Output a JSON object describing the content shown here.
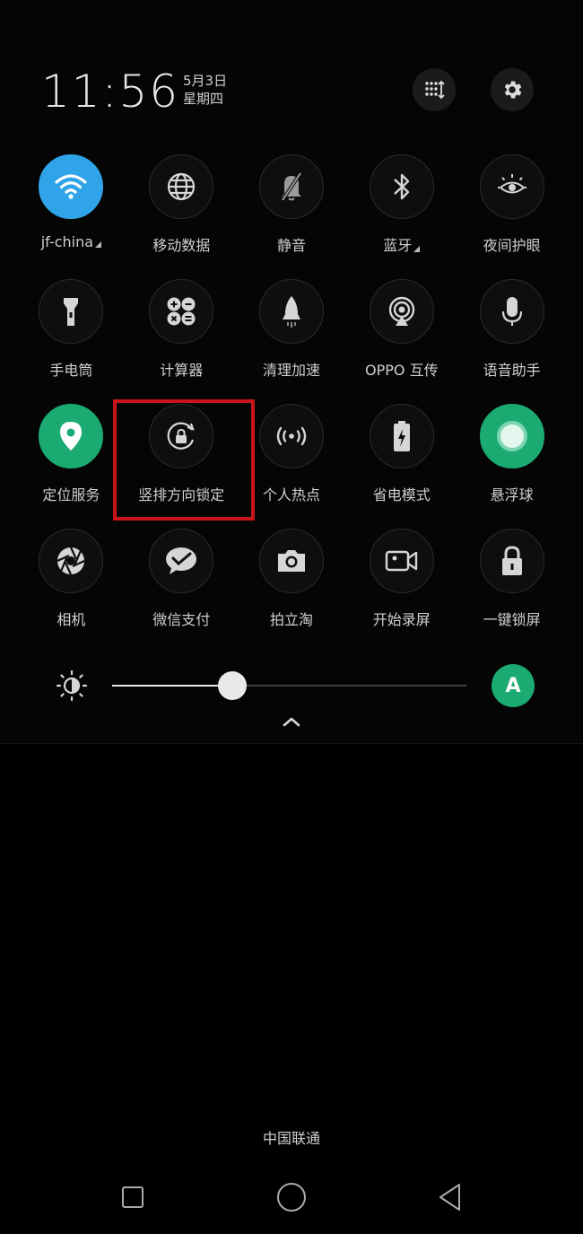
{
  "status": {
    "time": "11:56",
    "date": "5月3日",
    "weekday": "星期四"
  },
  "header_buttons": [
    {
      "name": "edit-tiles-button",
      "icon": "grid-sort-icon"
    },
    {
      "name": "settings-button",
      "icon": "gear-icon"
    }
  ],
  "tiles": [
    {
      "label": "jf-china",
      "icon": "wifi-icon",
      "active": "blue",
      "expandable": true
    },
    {
      "label": "移动数据",
      "icon": "globe-icon"
    },
    {
      "label": "静音",
      "icon": "bell-off-icon"
    },
    {
      "label": "蓝牙",
      "icon": "bluetooth-icon",
      "expandable": true
    },
    {
      "label": "夜间护眼",
      "icon": "eye-sun-icon"
    },
    {
      "label": "手电筒",
      "icon": "flashlight-icon"
    },
    {
      "label": "计算器",
      "icon": "calculator-icon"
    },
    {
      "label": "清理加速",
      "icon": "rocket-icon"
    },
    {
      "label": "OPPO 互传",
      "icon": "share-signal-icon"
    },
    {
      "label": "语音助手",
      "icon": "microphone-icon"
    },
    {
      "label": "定位服务",
      "icon": "location-pin-icon",
      "active": "green"
    },
    {
      "label": "竖排方向锁定",
      "icon": "rotation-lock-icon"
    },
    {
      "label": "个人热点",
      "icon": "hotspot-icon"
    },
    {
      "label": "省电模式",
      "icon": "battery-saver-icon"
    },
    {
      "label": "悬浮球",
      "icon": "floating-ball-icon",
      "active": "green"
    },
    {
      "label": "相机",
      "icon": "aperture-icon"
    },
    {
      "label": "微信支付",
      "icon": "wechat-pay-icon"
    },
    {
      "label": "拍立淘",
      "icon": "camera-icon"
    },
    {
      "label": "开始录屏",
      "icon": "screen-record-icon"
    },
    {
      "label": "一键锁屏",
      "icon": "padlock-icon"
    }
  ],
  "brightness": {
    "level": 0.34,
    "auto_label": "A"
  },
  "carrier": "中国联通",
  "colors": {
    "blue": "#2fa4e8",
    "green": "#1bab72",
    "highlight": "#c8151b"
  }
}
